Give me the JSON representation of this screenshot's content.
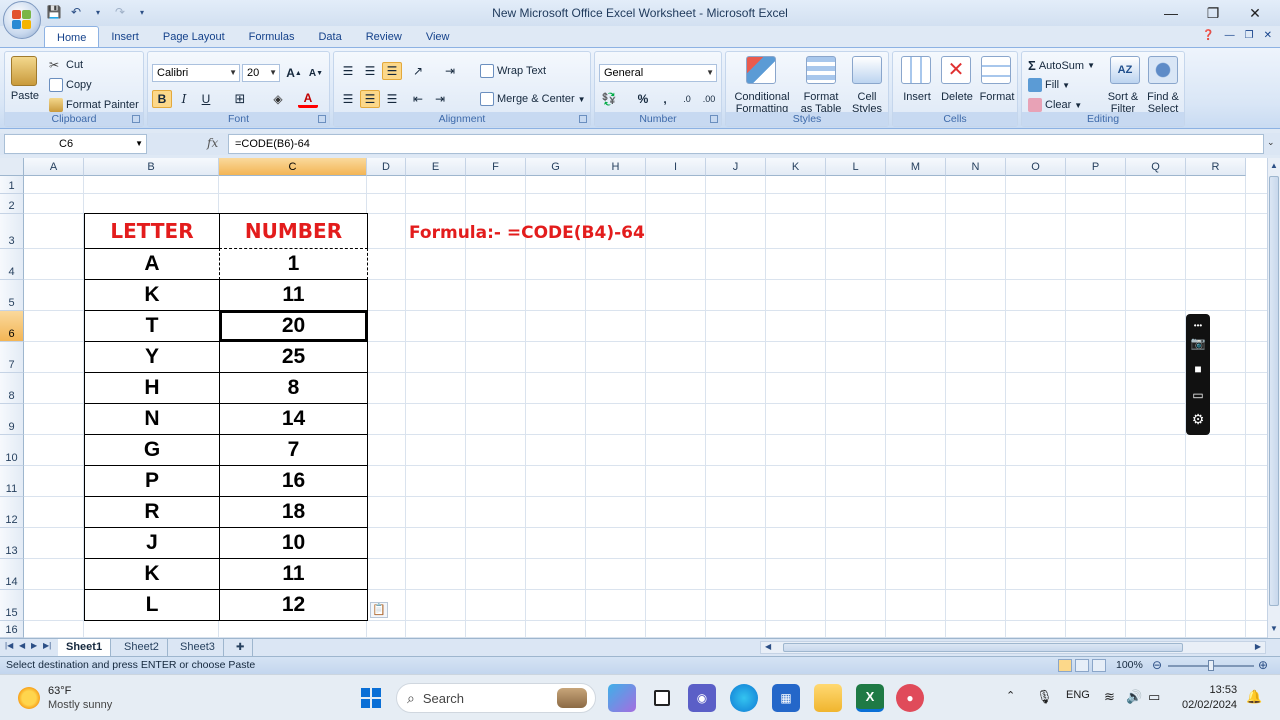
{
  "window": {
    "title": "New Microsoft Office Excel Worksheet - Microsoft Excel",
    "minimize": "—",
    "restore": "❐",
    "close": "✕"
  },
  "ribbon": {
    "tabs": [
      "Home",
      "Insert",
      "Page Layout",
      "Formulas",
      "Data",
      "Review",
      "View"
    ],
    "clipboard": {
      "label": "Clipboard",
      "paste": "Paste",
      "cut": "Cut",
      "copy": "Copy",
      "format_painter": "Format Painter"
    },
    "font": {
      "label": "Font",
      "name": "Calibri",
      "size": "20",
      "bold": "B",
      "italic": "I",
      "underline": "U"
    },
    "alignment": {
      "label": "Alignment",
      "wrap_text": "Wrap Text",
      "merge_center": "Merge & Center"
    },
    "number": {
      "label": "Number",
      "format": "General",
      "percent": "%",
      "comma": ","
    },
    "styles": {
      "label": "Styles",
      "conditional_1": "Conditional",
      "conditional_2": "Formatting",
      "format_table_1": "Format",
      "format_table_2": "as Table",
      "cell_styles_1": "Cell",
      "cell_styles_2": "Styles"
    },
    "cells": {
      "label": "Cells",
      "insert": "Insert",
      "delete": "Delete",
      "format": "Format"
    },
    "editing": {
      "label": "Editing",
      "autosum": "AutoSum",
      "fill": "Fill",
      "clear": "Clear",
      "sort_1": "Sort &",
      "sort_2": "Filter",
      "find_1": "Find &",
      "find_2": "Select"
    }
  },
  "formula_bar": {
    "name_box": "C6",
    "fx": "fx",
    "formula": "=CODE(B6)-64"
  },
  "grid": {
    "columns": [
      "A",
      "B",
      "C",
      "D",
      "E",
      "F",
      "G",
      "H",
      "I",
      "J",
      "K",
      "L",
      "M",
      "N",
      "O",
      "P",
      "Q",
      "R"
    ],
    "selected_column": "C",
    "rows": [
      "1",
      "2",
      "3",
      "4",
      "5",
      "6",
      "7",
      "8",
      "9",
      "10",
      "11",
      "12",
      "13",
      "14",
      "15",
      "16"
    ],
    "selected_row": "6"
  },
  "table": {
    "header_letter": "LETTER",
    "header_number": "NUMBER",
    "rows": [
      {
        "letter": "A",
        "number": "1"
      },
      {
        "letter": "K",
        "number": "11"
      },
      {
        "letter": "T",
        "number": "20"
      },
      {
        "letter": "Y",
        "number": "25"
      },
      {
        "letter": "H",
        "number": "8"
      },
      {
        "letter": "N",
        "number": "14"
      },
      {
        "letter": "G",
        "number": "7"
      },
      {
        "letter": "P",
        "number": "16"
      },
      {
        "letter": "R",
        "number": "18"
      },
      {
        "letter": "J",
        "number": "10"
      },
      {
        "letter": "K",
        "number": "11"
      },
      {
        "letter": "L",
        "number": "12"
      }
    ]
  },
  "note": "Formula:- =CODE(B4)-64",
  "sheets": [
    "Sheet1",
    "Sheet2",
    "Sheet3"
  ],
  "active_sheet": "Sheet1",
  "status": {
    "message": "Select destination and press ENTER or choose Paste",
    "zoom": "100%"
  },
  "taskbar": {
    "weather_temp": "63°F",
    "weather_text": "Mostly sunny",
    "search": "Search",
    "language": "ENG",
    "time": "13:53",
    "date": "02/02/2024"
  }
}
